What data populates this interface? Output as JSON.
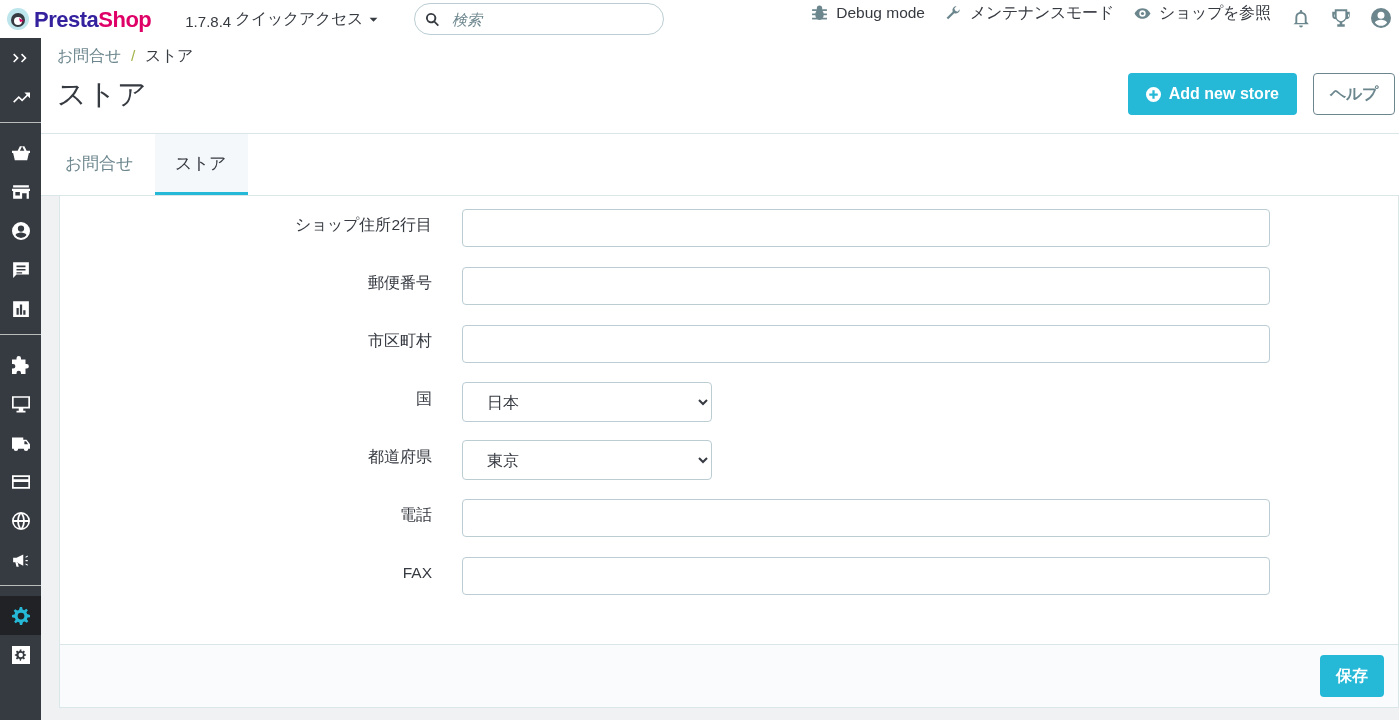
{
  "header": {
    "logo": {
      "parts": [
        "Presta",
        "Shop"
      ]
    },
    "version": "1.7.8.4",
    "quick_access": "クイックアクセス",
    "search": {
      "placeholder": "検索"
    },
    "links": [
      {
        "kind": "bug",
        "label": "Debug mode"
      },
      {
        "kind": "wrench",
        "label": "メンテナンスモード"
      },
      {
        "kind": "eye",
        "label": "ショップを参照"
      }
    ],
    "icons": [
      {
        "kind": "bell"
      },
      {
        "kind": "trophy"
      },
      {
        "kind": "user"
      }
    ]
  },
  "sidebar": {
    "groups": [
      [
        {
          "kind": "collapse",
          "selected": false
        },
        {
          "kind": "trend",
          "selected": false
        }
      ],
      [
        {
          "kind": "basket",
          "selected": false
        },
        {
          "kind": "store",
          "selected": false
        },
        {
          "kind": "user",
          "selected": false
        },
        {
          "kind": "chat",
          "selected": false
        },
        {
          "kind": "chart",
          "selected": false
        }
      ],
      [
        {
          "kind": "puzzle",
          "selected": false
        },
        {
          "kind": "monitor",
          "selected": false
        },
        {
          "kind": "truck",
          "selected": false
        },
        {
          "kind": "card",
          "selected": false
        },
        {
          "kind": "globe",
          "selected": false
        },
        {
          "kind": "megaphone",
          "selected": false
        }
      ],
      [
        {
          "kind": "gear",
          "selected": true
        },
        {
          "kind": "gearbox",
          "selected": false
        }
      ]
    ]
  },
  "breadcrumb": {
    "items": [
      "お問合せ",
      "ストア"
    ],
    "separator": "/"
  },
  "title": "ストア",
  "actions": [
    {
      "kind": "primary",
      "label": "Add new store"
    },
    {
      "kind": "outline",
      "label": "ヘルプ"
    }
  ],
  "tabs": [
    {
      "label": "お問合せ",
      "selected": false
    },
    {
      "label": "ストア",
      "selected": true
    }
  ],
  "form": {
    "fields": [
      {
        "label": "ショップ住所2行目",
        "kind": "text"
      },
      {
        "label": "郵便番号",
        "kind": "text"
      },
      {
        "label": "市区町村",
        "kind": "text"
      },
      {
        "label": "国",
        "kind": "select",
        "value": "日本"
      },
      {
        "label": "都道府県",
        "kind": "select",
        "value": "東京"
      },
      {
        "label": "電話",
        "kind": "text"
      },
      {
        "label": "FAX",
        "kind": "text"
      }
    ],
    "save": "保存"
  }
}
